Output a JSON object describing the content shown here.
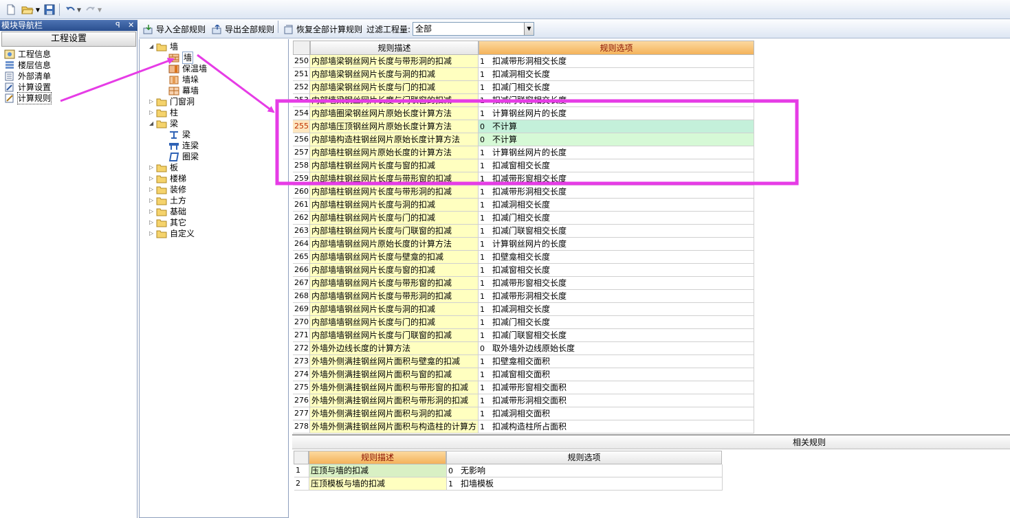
{
  "toolbar": {
    "icons": [
      "new-file-icon",
      "open-folder-icon",
      "save-icon",
      "undo-icon",
      "redo-icon"
    ]
  },
  "nav": {
    "title": "模块导航栏",
    "pin_glyph": "ꟼ",
    "close_glyph": "✕",
    "project_settings": "工程设置",
    "items": [
      {
        "label": "工程信息"
      },
      {
        "label": "楼层信息"
      },
      {
        "label": "外部清单"
      },
      {
        "label": "计算设置"
      },
      {
        "label": "计算规则"
      }
    ]
  },
  "rule_toolbar": {
    "import_all": "导入全部规则",
    "export_all": "导出全部规则",
    "restore_all": "恢复全部计算规则",
    "filter_label": "过滤工程量:",
    "filter_value": "全部"
  },
  "tree": {
    "nodes": [
      {
        "label": "墙"
      },
      {
        "label": "墙"
      },
      {
        "label": "保温墙"
      },
      {
        "label": "墙垛"
      },
      {
        "label": "幕墙"
      },
      {
        "label": "门窗洞"
      },
      {
        "label": "柱"
      },
      {
        "label": "梁"
      },
      {
        "label": "梁"
      },
      {
        "label": "连梁"
      },
      {
        "label": "圈梁"
      },
      {
        "label": "板"
      },
      {
        "label": "楼梯"
      },
      {
        "label": "装修"
      },
      {
        "label": "土方"
      },
      {
        "label": "基础"
      },
      {
        "label": "其它"
      },
      {
        "label": "自定义"
      }
    ]
  },
  "grid": {
    "col_desc": "规则描述",
    "col_opt": "规则选项",
    "rows": [
      {
        "no": "250",
        "desc": "内部墙梁钢丝网片长度与带形洞的扣减",
        "code": "1",
        "opt": "扣减带形洞相交长度"
      },
      {
        "no": "251",
        "desc": "内部墙梁钢丝网片长度与洞的扣减",
        "code": "1",
        "opt": "扣减洞相交长度"
      },
      {
        "no": "252",
        "desc": "内部墙梁钢丝网片长度与门的扣减",
        "code": "1",
        "opt": "扣减门相交长度"
      },
      {
        "no": "253",
        "desc": "内部墙梁钢丝网片长度与门联窗的扣减",
        "code": "1",
        "opt": "扣减门联窗相交长度"
      },
      {
        "no": "254",
        "desc": "内部墙圈梁钢丝网片原始长度计算方法",
        "code": "1",
        "opt": "计算钢丝网片的长度"
      },
      {
        "no": "255",
        "desc": "内部墙压顶钢丝网片原始长度计算方法",
        "code": "0",
        "opt": "不计算"
      },
      {
        "no": "256",
        "desc": "内部墙构造柱钢丝网片原始长度计算方法",
        "code": "0",
        "opt": "不计算"
      },
      {
        "no": "257",
        "desc": "内部墙柱钢丝网片原始长度的计算方法",
        "code": "1",
        "opt": "计算钢丝网片的长度"
      },
      {
        "no": "258",
        "desc": "内部墙柱钢丝网片长度与窗的扣减",
        "code": "1",
        "opt": "扣减窗相交长度"
      },
      {
        "no": "259",
        "desc": "内部墙柱钢丝网片长度与带形窗的扣减",
        "code": "1",
        "opt": "扣减带形窗相交长度"
      },
      {
        "no": "260",
        "desc": "内部墙柱钢丝网片长度与带形洞的扣减",
        "code": "1",
        "opt": "扣减带形洞相交长度"
      },
      {
        "no": "261",
        "desc": "内部墙柱钢丝网片长度与洞的扣减",
        "code": "1",
        "opt": "扣减洞相交长度"
      },
      {
        "no": "262",
        "desc": "内部墙柱钢丝网片长度与门的扣减",
        "code": "1",
        "opt": "扣减门相交长度"
      },
      {
        "no": "263",
        "desc": "内部墙柱钢丝网片长度与门联窗的扣减",
        "code": "1",
        "opt": "扣减门联窗相交长度"
      },
      {
        "no": "264",
        "desc": "内部墙墙钢丝网片原始长度的计算方法",
        "code": "1",
        "opt": "计算钢丝网片的长度"
      },
      {
        "no": "265",
        "desc": "内部墙墙钢丝网片长度与壁龛的扣减",
        "code": "1",
        "opt": "扣壁龛相交长度"
      },
      {
        "no": "266",
        "desc": "内部墙墙钢丝网片长度与窗的扣减",
        "code": "1",
        "opt": "扣减窗相交长度"
      },
      {
        "no": "267",
        "desc": "内部墙墙钢丝网片长度与带形窗的扣减",
        "code": "1",
        "opt": "扣减带形窗相交长度"
      },
      {
        "no": "268",
        "desc": "内部墙墙钢丝网片长度与带形洞的扣减",
        "code": "1",
        "opt": "扣减带形洞相交长度"
      },
      {
        "no": "269",
        "desc": "内部墙墙钢丝网片长度与洞的扣减",
        "code": "1",
        "opt": "扣减洞相交长度"
      },
      {
        "no": "270",
        "desc": "内部墙墙钢丝网片长度与门的扣减",
        "code": "1",
        "opt": "扣减门相交长度"
      },
      {
        "no": "271",
        "desc": "内部墙墙钢丝网片长度与门联窗的扣减",
        "code": "1",
        "opt": "扣减门联窗相交长度"
      },
      {
        "no": "272",
        "desc": "外墙外边线长度的计算方法",
        "code": "0",
        "opt": "取外墙外边线原始长度"
      },
      {
        "no": "273",
        "desc": "外墙外侧满挂钢丝网片面积与壁龛的扣减",
        "code": "1",
        "opt": "扣壁龛相交面积"
      },
      {
        "no": "274",
        "desc": "外墙外侧满挂钢丝网片面积与窗的扣减",
        "code": "1",
        "opt": "扣减窗相交面积"
      },
      {
        "no": "275",
        "desc": "外墙外侧满挂钢丝网片面积与带形窗的扣减",
        "code": "1",
        "opt": "扣减带形窗相交面积"
      },
      {
        "no": "276",
        "desc": "外墙外侧满挂钢丝网片面积与带形洞的扣减",
        "code": "1",
        "opt": "扣减带形洞相交面积"
      },
      {
        "no": "277",
        "desc": "外墙外侧满挂钢丝网片面积与洞的扣减",
        "code": "1",
        "opt": "扣减洞相交面积"
      },
      {
        "no": "278",
        "desc": "外墙外侧满挂钢丝网片面积与构造柱的计算方",
        "code": "1",
        "opt": "扣减构造柱所占面积"
      }
    ]
  },
  "related": {
    "title": "相关规则",
    "col_desc": "规则描述",
    "col_opt": "规则选项",
    "rows": [
      {
        "no": "1",
        "desc": "压顶与墙的扣减",
        "code": "0",
        "opt": "无影响"
      },
      {
        "no": "2",
        "desc": "压顶模板与墙的扣减",
        "code": "1",
        "opt": "扣墙模板"
      }
    ]
  },
  "annotation": {
    "highlight_color": "#e63ce6"
  }
}
